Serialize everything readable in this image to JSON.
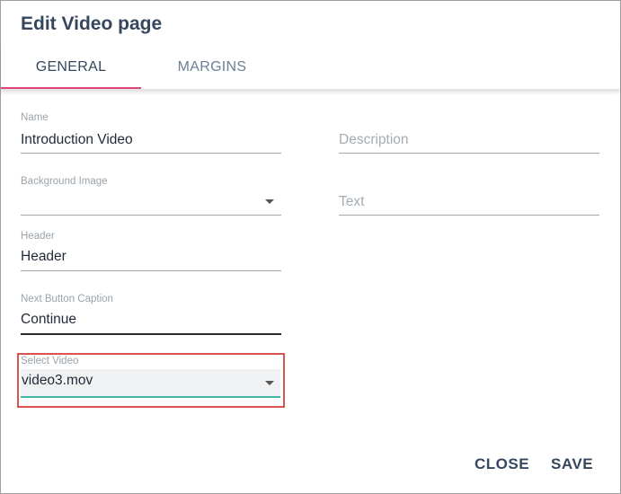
{
  "dialog": {
    "title": "Edit Video page"
  },
  "tabs": [
    {
      "label": "GENERAL",
      "active": true
    },
    {
      "label": "MARGINS",
      "active": false
    }
  ],
  "form": {
    "name": {
      "label": "Name",
      "value": "Introduction Video"
    },
    "background_image": {
      "label": "Background Image",
      "value": ""
    },
    "header": {
      "label": "Header",
      "value": "Header"
    },
    "next_button_caption": {
      "label": "Next Button Caption",
      "value": "Continue"
    },
    "select_video": {
      "label": "Select Video",
      "value": "video3.mov"
    },
    "description": {
      "placeholder": "Description"
    },
    "text": {
      "placeholder": "Text"
    }
  },
  "actions": {
    "close_label": "CLOSE",
    "save_label": "SAVE"
  },
  "colors": {
    "accent_tab_indicator": "#e0467a",
    "focus_underline": "#3fb8a8",
    "highlight_border": "#d9534f",
    "title_text": "#35475e"
  },
  "icons": {
    "dropdown": "caret-down-icon"
  }
}
